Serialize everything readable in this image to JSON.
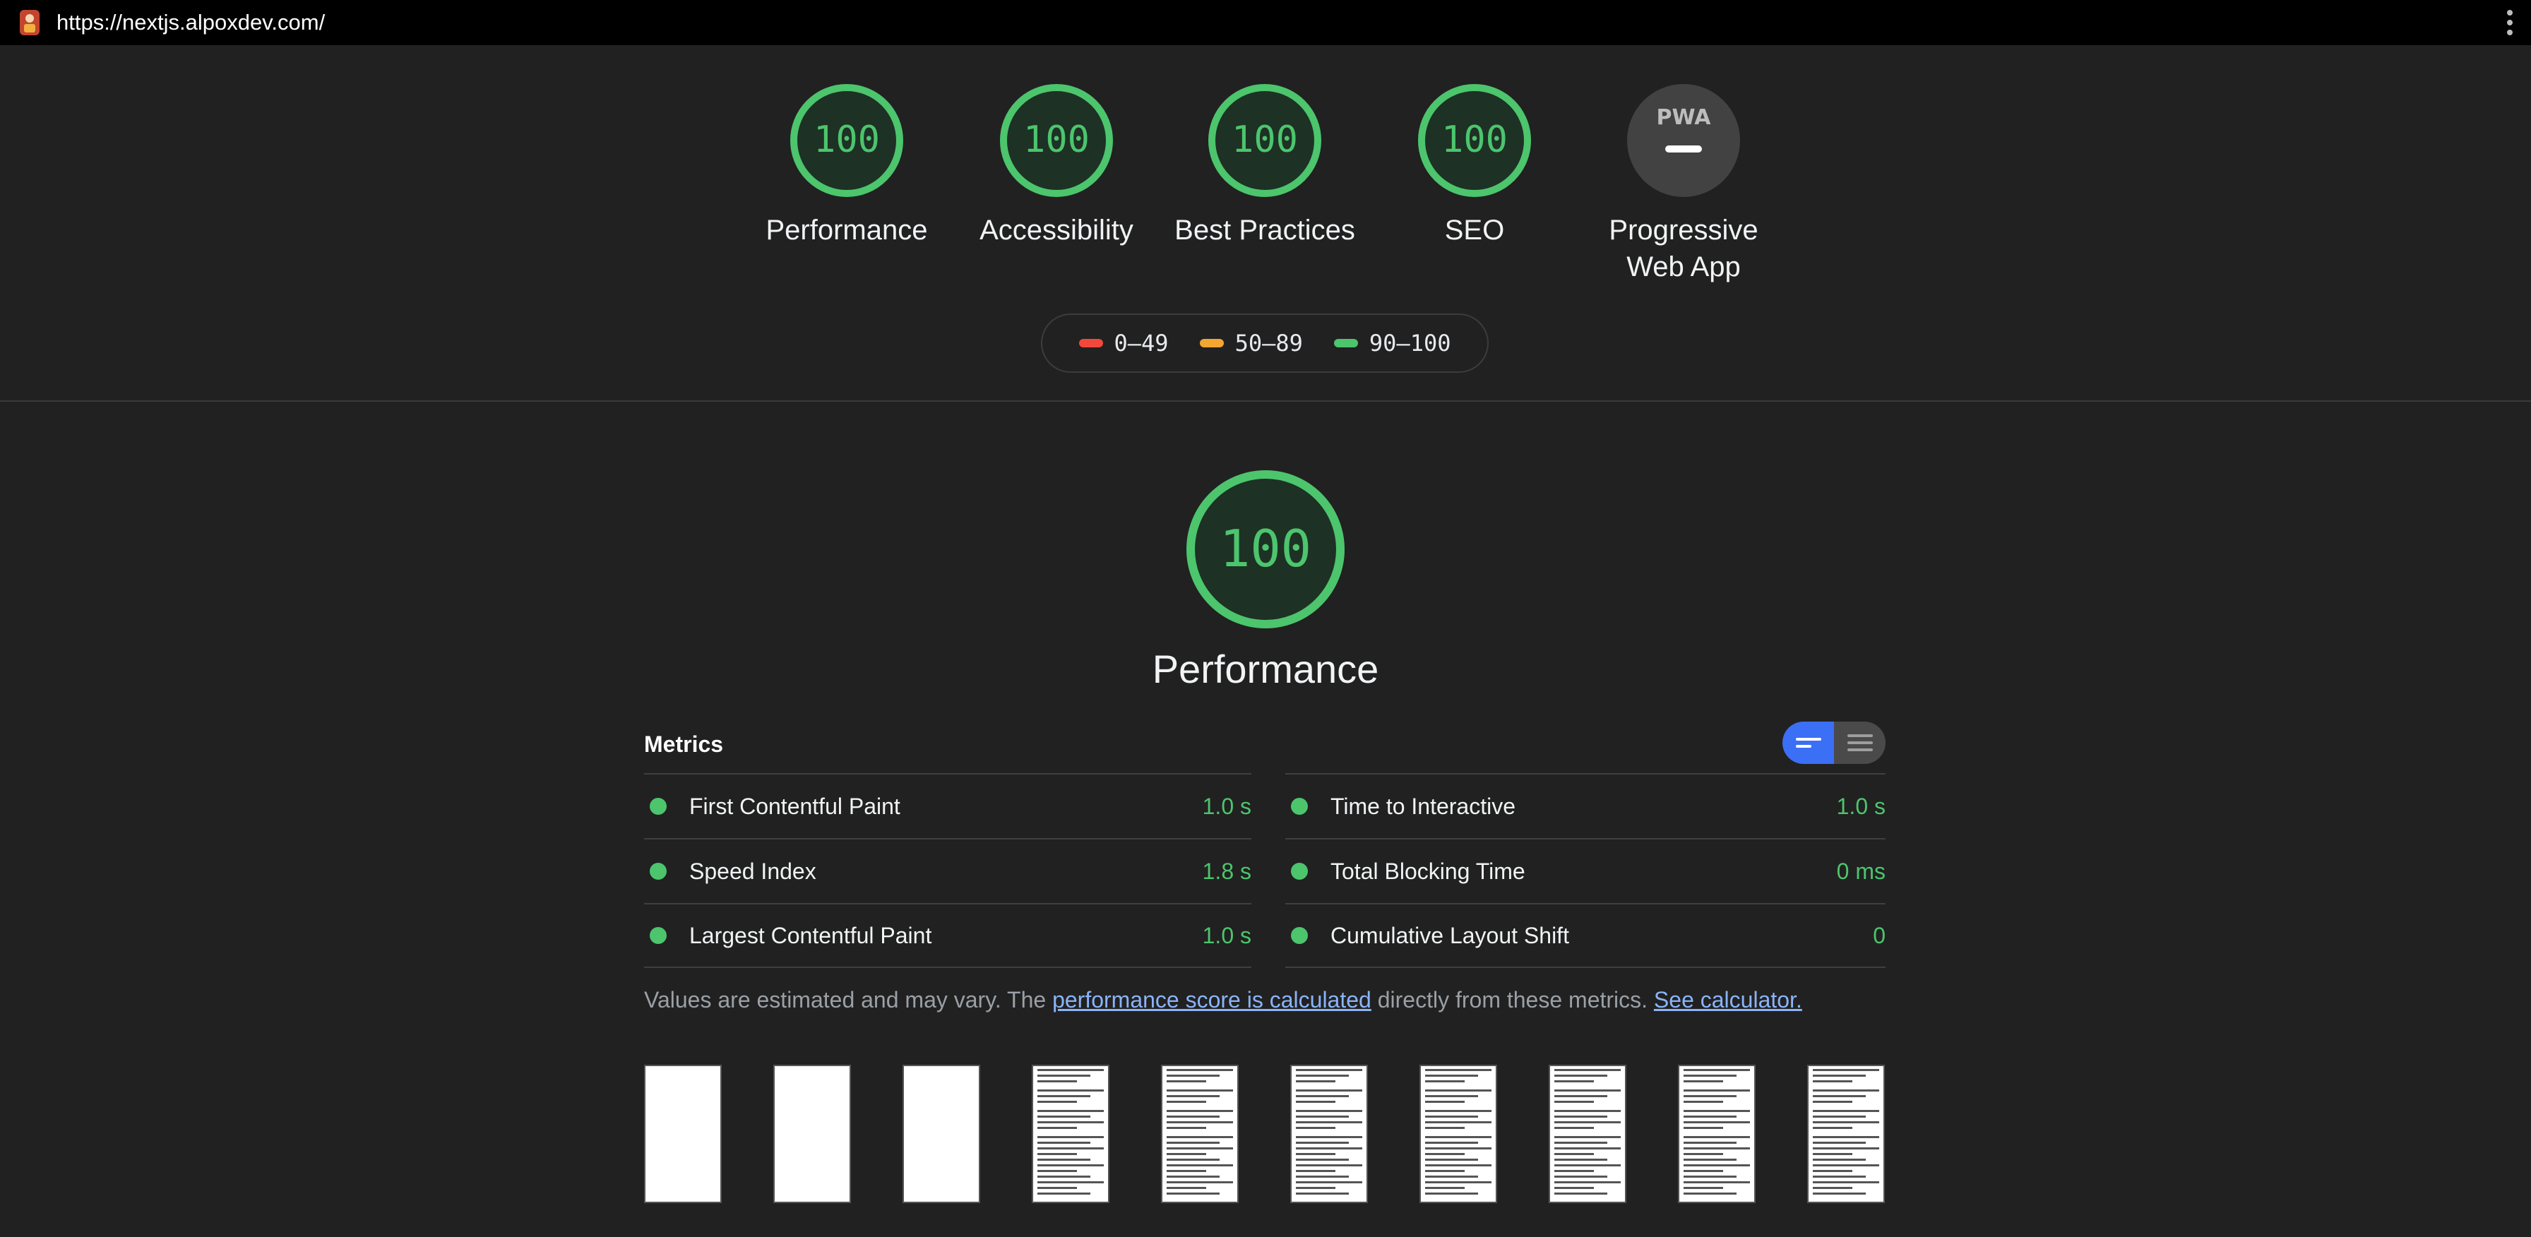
{
  "browser": {
    "url": "https://nextjs.alpoxdev.com/",
    "favicon_icon": "app-favicon",
    "menu_icon": "kebab-menu-icon"
  },
  "scores": [
    {
      "label": "Performance",
      "score": "100"
    },
    {
      "label": "Accessibility",
      "score": "100"
    },
    {
      "label": "Best Practices",
      "score": "100"
    },
    {
      "label": "SEO",
      "score": "100"
    },
    {
      "label_line1": "Progressive",
      "label_line2": "Web App",
      "badge": "PWA"
    }
  ],
  "legend": [
    {
      "label": "0–49",
      "color": "#f4473c"
    },
    {
      "label": "50–89",
      "color": "#f3a630"
    },
    {
      "label": "90–100",
      "color": "#4cc56d"
    }
  ],
  "performance": {
    "score": "100",
    "title": "Performance"
  },
  "metrics": {
    "title": "Metrics",
    "left": [
      {
        "name": "First Contentful Paint",
        "value": "1.0 s"
      },
      {
        "name": "Speed Index",
        "value": "1.8 s"
      },
      {
        "name": "Largest Contentful Paint",
        "value": "1.0 s"
      }
    ],
    "right": [
      {
        "name": "Time to Interactive",
        "value": "1.0 s"
      },
      {
        "name": "Total Blocking Time",
        "value": "0 ms"
      },
      {
        "name": "Cumulative Layout Shift",
        "value": "0"
      }
    ]
  },
  "note": {
    "prefix": "Values are estimated and may vary. The ",
    "link1": "performance score is calculated",
    "middle": " directly from these metrics. ",
    "link2": "See calculator."
  },
  "colors": {
    "pass": "#4cc56d",
    "background": "#212121",
    "toggle_active": "#3b6ff5"
  }
}
